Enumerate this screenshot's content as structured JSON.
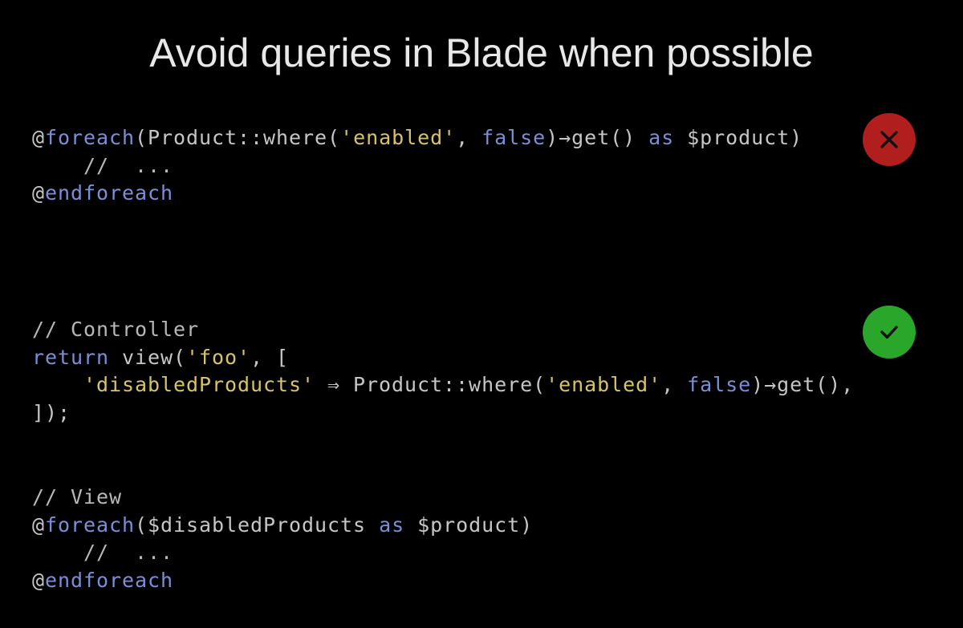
{
  "title": "Avoid queries in Blade when possible",
  "colors": {
    "background": "#000000",
    "title": "#e8e8e8",
    "plain": "#c6c6c6",
    "keyword": "#7b8fd6",
    "string": "#d7c36a",
    "bad_badge": "#b01e1e",
    "good_badge": "#2aa62a"
  },
  "examples": {
    "bad": {
      "verdict_icon": "x-mark-icon",
      "lines": [
        [
          {
            "t": "@",
            "k": "plain"
          },
          {
            "t": "foreach",
            "k": "keyword"
          },
          {
            "t": "(Product::where(",
            "k": "plain"
          },
          {
            "t": "'enabled'",
            "k": "string"
          },
          {
            "t": ", ",
            "k": "plain"
          },
          {
            "t": "false",
            "k": "keyword"
          },
          {
            "t": ")→get() ",
            "k": "plain"
          },
          {
            "t": "as",
            "k": "keyword"
          },
          {
            "t": " $product)",
            "k": "plain"
          }
        ],
        [
          {
            "t": "    //  ...",
            "k": "comment"
          }
        ],
        [
          {
            "t": "@",
            "k": "plain"
          },
          {
            "t": "endforeach",
            "k": "keyword"
          }
        ]
      ]
    },
    "good_controller": {
      "verdict_icon": "checkmark-icon",
      "lines": [
        [
          {
            "t": "// Controller",
            "k": "comment"
          }
        ],
        [
          {
            "t": "return",
            "k": "keyword"
          },
          {
            "t": " view(",
            "k": "plain"
          },
          {
            "t": "'foo'",
            "k": "string"
          },
          {
            "t": ", [",
            "k": "plain"
          }
        ],
        [
          {
            "t": "    ",
            "k": "plain"
          },
          {
            "t": "'disabledProducts'",
            "k": "string"
          },
          {
            "t": " ⇒ Product::where(",
            "k": "plain"
          },
          {
            "t": "'enabled'",
            "k": "string"
          },
          {
            "t": ", ",
            "k": "plain"
          },
          {
            "t": "false",
            "k": "keyword"
          },
          {
            "t": ")→get(),",
            "k": "plain"
          }
        ],
        [
          {
            "t": "]);",
            "k": "plain"
          }
        ]
      ]
    },
    "good_view": {
      "lines": [
        [
          {
            "t": "// View",
            "k": "comment"
          }
        ],
        [
          {
            "t": "@",
            "k": "plain"
          },
          {
            "t": "foreach",
            "k": "keyword"
          },
          {
            "t": "($disabledProducts ",
            "k": "plain"
          },
          {
            "t": "as",
            "k": "keyword"
          },
          {
            "t": " $product)",
            "k": "plain"
          }
        ],
        [
          {
            "t": "    //  ...",
            "k": "comment"
          }
        ],
        [
          {
            "t": "@",
            "k": "plain"
          },
          {
            "t": "endforeach",
            "k": "keyword"
          }
        ]
      ]
    }
  }
}
